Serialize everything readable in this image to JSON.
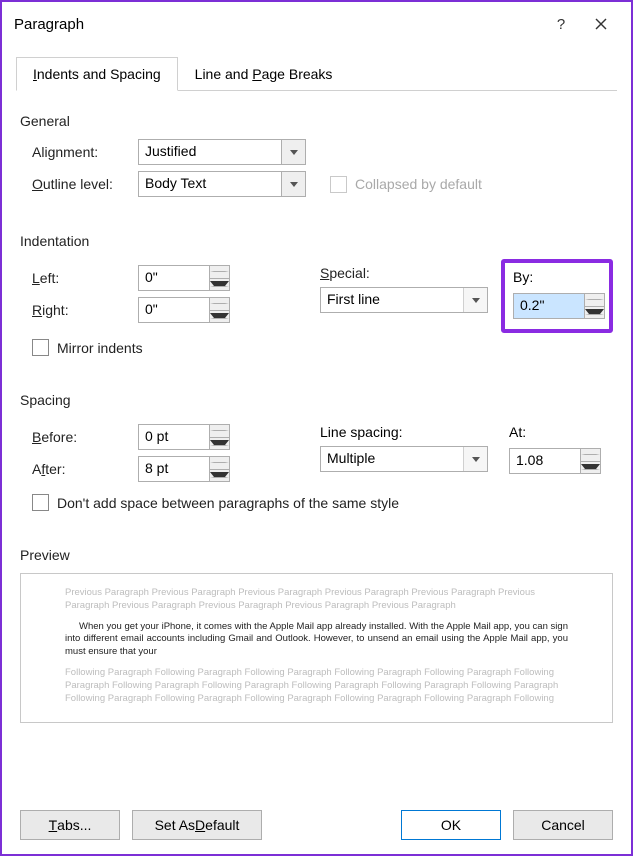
{
  "title": "Paragraph",
  "tabs": {
    "indents": "Indents and Spacing",
    "breaks": "Line and Page Breaks"
  },
  "general": {
    "heading": "General",
    "alignment_label": "Alignment:",
    "alignment_value": "Justified",
    "outline_label": "Outline level:",
    "outline_value": "Body Text",
    "collapsed_label": "Collapsed by default"
  },
  "indent": {
    "heading": "Indentation",
    "left_label": "Left:",
    "left_value": "0\"",
    "right_label": "Right:",
    "right_value": "0\"",
    "special_label": "Special:",
    "special_value": "First line",
    "by_label": "By:",
    "by_value": "0.2\"",
    "mirror_label": "Mirror indents"
  },
  "spacing": {
    "heading": "Spacing",
    "before_label": "Before:",
    "before_value": "0 pt",
    "after_label": "After:",
    "after_value": "8 pt",
    "line_label": "Line spacing:",
    "line_value": "Multiple",
    "at_label": "At:",
    "at_value": "1.08",
    "dont_add_label": "Don't add space between paragraphs of the same style"
  },
  "preview": {
    "heading": "Preview",
    "prev_text": "Previous Paragraph Previous Paragraph Previous Paragraph Previous Paragraph Previous Paragraph Previous Paragraph Previous Paragraph Previous Paragraph Previous Paragraph Previous Paragraph",
    "sample_text": "When you get your iPhone, it comes with the Apple Mail app already installed. With the Apple Mail app, you can sign into different email accounts including Gmail and Outlook. However, to unsend an email using the Apple Mail app, you must ensure that your",
    "next_text": "Following Paragraph Following Paragraph Following Paragraph Following Paragraph Following Paragraph Following Paragraph Following Paragraph Following Paragraph Following Paragraph Following Paragraph Following Paragraph Following Paragraph Following Paragraph Following Paragraph Following Paragraph Following Paragraph Following"
  },
  "buttons": {
    "tabs": "Tabs...",
    "default": "Set As Default",
    "ok": "OK",
    "cancel": "Cancel"
  }
}
